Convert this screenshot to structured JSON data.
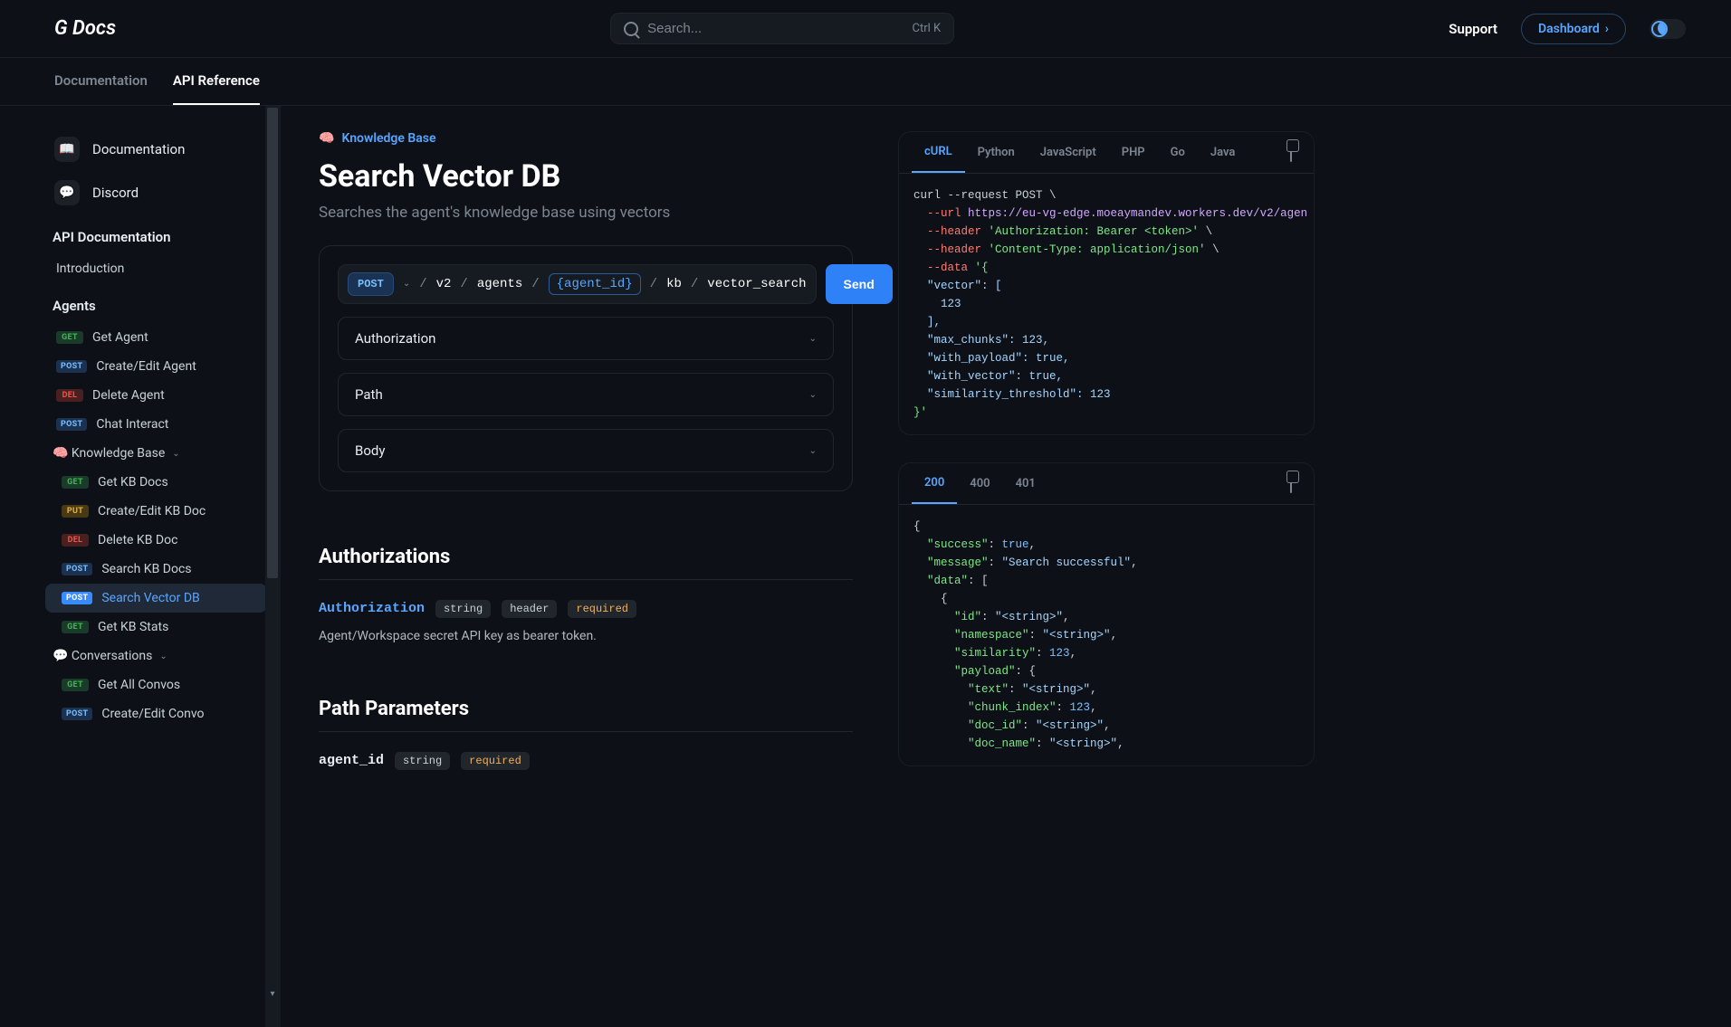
{
  "header": {
    "logo": "G Docs",
    "search_placeholder": "Search...",
    "search_kbd": "Ctrl K",
    "support_label": "Support",
    "dashboard_label": "Dashboard"
  },
  "tabs": {
    "documentation": "Documentation",
    "api_reference": "API Reference"
  },
  "sidebar": {
    "top_links": [
      {
        "icon": "📖",
        "label": "Documentation"
      },
      {
        "icon": "💬",
        "label": "Discord"
      }
    ],
    "section_api_doc": "API Documentation",
    "introduction": "Introduction",
    "section_agents": "Agents",
    "agents": [
      {
        "method": "GET",
        "label": "Get Agent"
      },
      {
        "method": "POST",
        "label": "Create/Edit Agent"
      },
      {
        "method": "DEL",
        "label": "Delete Agent"
      },
      {
        "method": "POST",
        "label": "Chat Interact"
      }
    ],
    "kb_category": "🧠 Knowledge Base",
    "kb_items": [
      {
        "method": "GET",
        "label": "Get KB Docs"
      },
      {
        "method": "PUT",
        "label": "Create/Edit KB Doc"
      },
      {
        "method": "DEL",
        "label": "Delete KB Doc"
      },
      {
        "method": "POST",
        "label": "Search KB Docs"
      },
      {
        "method": "POST",
        "label": "Search Vector DB",
        "active": true
      },
      {
        "method": "GET",
        "label": "Get KB Stats"
      }
    ],
    "convo_category": "💬 Conversations",
    "convo_items": [
      {
        "method": "GET",
        "label": "Get All Convos"
      },
      {
        "method": "POST",
        "label": "Create/Edit Convo"
      }
    ]
  },
  "content": {
    "breadcrumb_icon": "🧠",
    "breadcrumb_label": "Knowledge Base",
    "title": "Search Vector DB",
    "description": "Searches the agent's knowledge base using vectors",
    "request": {
      "method": "POST",
      "path_parts": [
        "v2",
        "agents"
      ],
      "path_param": "{agent_id}",
      "path_tail": [
        "kb",
        "vector_search"
      ],
      "send_label": "Send"
    },
    "collapse": {
      "authorization": "Authorization",
      "path": "Path",
      "body": "Body"
    },
    "authorizations": {
      "heading": "Authorizations",
      "param_name": "Authorization",
      "tag_string": "string",
      "tag_header": "header",
      "tag_required": "required",
      "desc": "Agent/Workspace secret API key as bearer token."
    },
    "path_params": {
      "heading": "Path Parameters",
      "param_name": "agent_id",
      "tag_string": "string",
      "tag_required": "required"
    }
  },
  "code": {
    "request_tabs": [
      "cURL",
      "Python",
      "JavaScript",
      "PHP",
      "Go",
      "Java"
    ],
    "request_active": "cURL",
    "curl": {
      "line1_a": "curl --request ",
      "line1_b": "POST",
      "line1_c": " \\",
      "line2_a": "  --url",
      "line2_b": " https://eu-vg-edge.moeaymandev.workers.dev/v2/agen",
      "line3_a": "  --header",
      "line3_b": " 'Authorization: Bearer <token>'",
      "line3_c": " \\",
      "line4_a": "  --header",
      "line4_b": " 'Content-Type: application/json'",
      "line4_c": " \\",
      "line5_a": "  --data",
      "line5_b": " '{",
      "l6": "  \"vector\": [",
      "l7": "    123",
      "l8": "  ],",
      "l9": "  \"max_chunks\": 123,",
      "l10": "  \"with_payload\": true,",
      "l11": "  \"with_vector\": true,",
      "l12": "  \"similarity_threshold\": 123",
      "l13": "}'"
    },
    "response_tabs": [
      "200",
      "400",
      "401"
    ],
    "response_active": "200",
    "response": {
      "l1": "{",
      "l2": "  \"success\": true,",
      "l3": "  \"message\": \"Search successful\",",
      "l4": "  \"data\": [",
      "l5": "    {",
      "l6": "      \"id\": \"<string>\",",
      "l7": "      \"namespace\": \"<string>\",",
      "l8": "      \"similarity\": 123,",
      "l9": "      \"payload\": {",
      "l10": "        \"text\": \"<string>\",",
      "l11": "        \"chunk_index\": 123,",
      "l12": "        \"doc_id\": \"<string>\",",
      "l13": "        \"doc_name\": \"<string>\","
    }
  }
}
